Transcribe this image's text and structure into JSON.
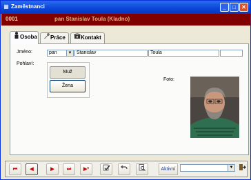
{
  "window": {
    "title": "Zaměstnanci"
  },
  "record": {
    "id": "0001",
    "name": "pan Stanislav Toula (Kladno)"
  },
  "tabs": [
    {
      "label": "Osoba",
      "icon": "person-icon"
    },
    {
      "label": "Práce",
      "icon": "tools-icon"
    },
    {
      "label": "Kontakt",
      "icon": "phone-icon"
    }
  ],
  "form": {
    "jmeno_label": "Jméno:",
    "salutation": "pan",
    "first_name": "Stanislav",
    "last_name": "Toula",
    "suffix": "",
    "pohlavi_label": "Pohlaví:",
    "gender_options": [
      "Muž",
      "Žena"
    ],
    "foto_label": "Foto:"
  },
  "nav": {
    "first_icon": "⏮",
    "prev_icon": "◀",
    "next_icon": "▶",
    "last_icon": "⏭",
    "new_icon": "▶*",
    "aktivni_label": "Aktivní",
    "filter_value": ""
  },
  "colors": {
    "record_bar": "#800000",
    "record_text": "#e4b078",
    "titlebar": "#0a45d8"
  }
}
